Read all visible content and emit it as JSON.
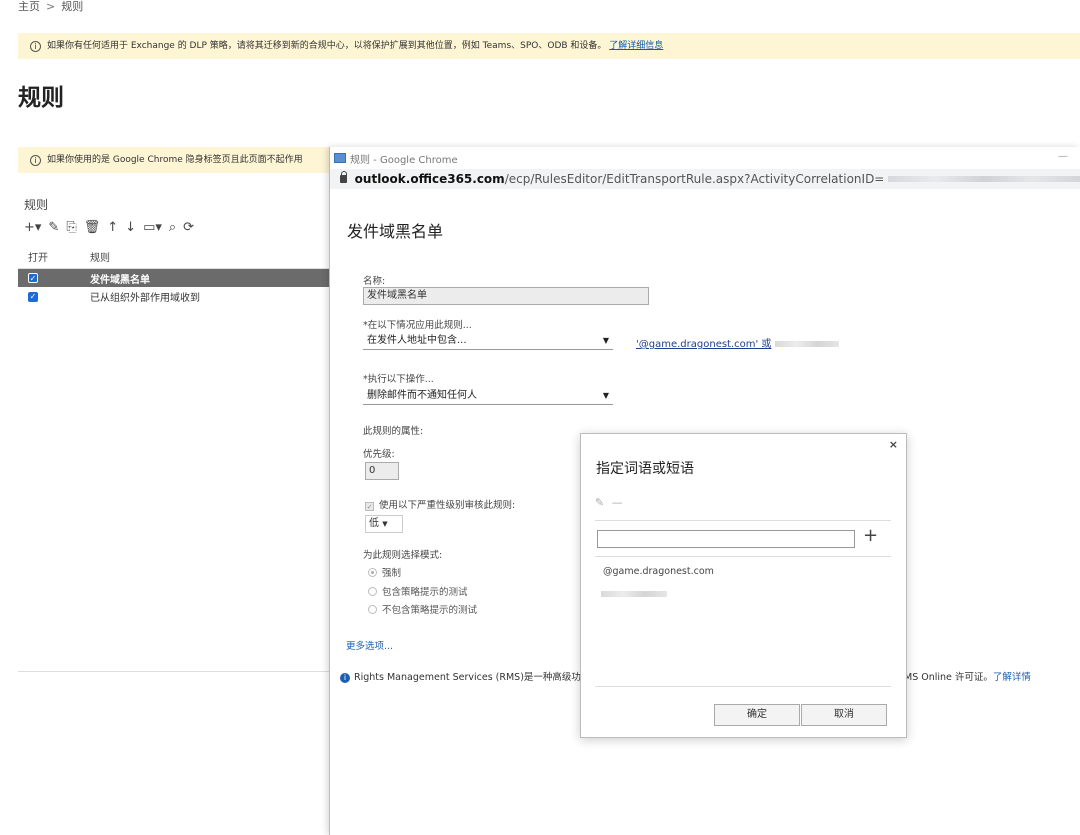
{
  "breadcrumb": {
    "home": "主页",
    "separator": ">",
    "current": "规则"
  },
  "banner_top": {
    "text": "如果你有任何适用于 Exchange 的 DLP 策略，请将其迁移到新的合规中心，以将保护扩展到其他位置，例如 Teams、SPO、ODB 和设备。",
    "link": "了解详细信息"
  },
  "page_title": "规则",
  "banner_chrome": {
    "text": "如果你使用的是 Google Chrome 隐身标签页且此页面不起作用"
  },
  "rules_panel": {
    "heading": "规则",
    "toolbar": [
      "+▾",
      "✎",
      "⎘",
      "🗑",
      "↑",
      "↓",
      "▭▾",
      "⌕",
      "⟳"
    ],
    "columns": [
      "打开",
      "规则"
    ],
    "rows": [
      {
        "on": true,
        "name": "发件域黑名单",
        "selected": true
      },
      {
        "on": true,
        "name": "已从组织外部作用域收到",
        "selected": false
      }
    ]
  },
  "popup": {
    "window_title": "规则 - Google Chrome",
    "url_host": "outlook.office365.com",
    "url_path": "/ecp/RulesEditor/EditTransportRule.aspx?ActivityCorrelationID=",
    "title": "发件域黑名单",
    "name_label": "名称:",
    "name_value": "发件域黑名单",
    "condition_label": "*在以下情况应用此规则...",
    "condition_value": "在发件人地址中包含...",
    "condition_link": "'@game.dragonest.com' 或",
    "action_label": "*执行以下操作...",
    "action_value": "删除邮件而不通知任何人",
    "props_label": "此规则的属性:",
    "priority_label": "优先级:",
    "priority_value": "0",
    "severity_label": "使用以下严重性级别审核此规则:",
    "severity_value": "低",
    "mode_label": "为此规则选择模式:",
    "modes": [
      "强制",
      "包含策略提示的测试",
      "不包含策略提示的测试"
    ],
    "more_options": "更多选项...",
    "rms_left": "Rights Management Services (RMS)是一种高级功",
    "rms_right": "MS Online 许可证。",
    "rms_link": "了解详情"
  },
  "dialog": {
    "title": "指定词语或短语",
    "close": "×",
    "add": "+",
    "items": [
      "@game.dragonest.com"
    ],
    "ok": "确定",
    "cancel": "取消"
  }
}
